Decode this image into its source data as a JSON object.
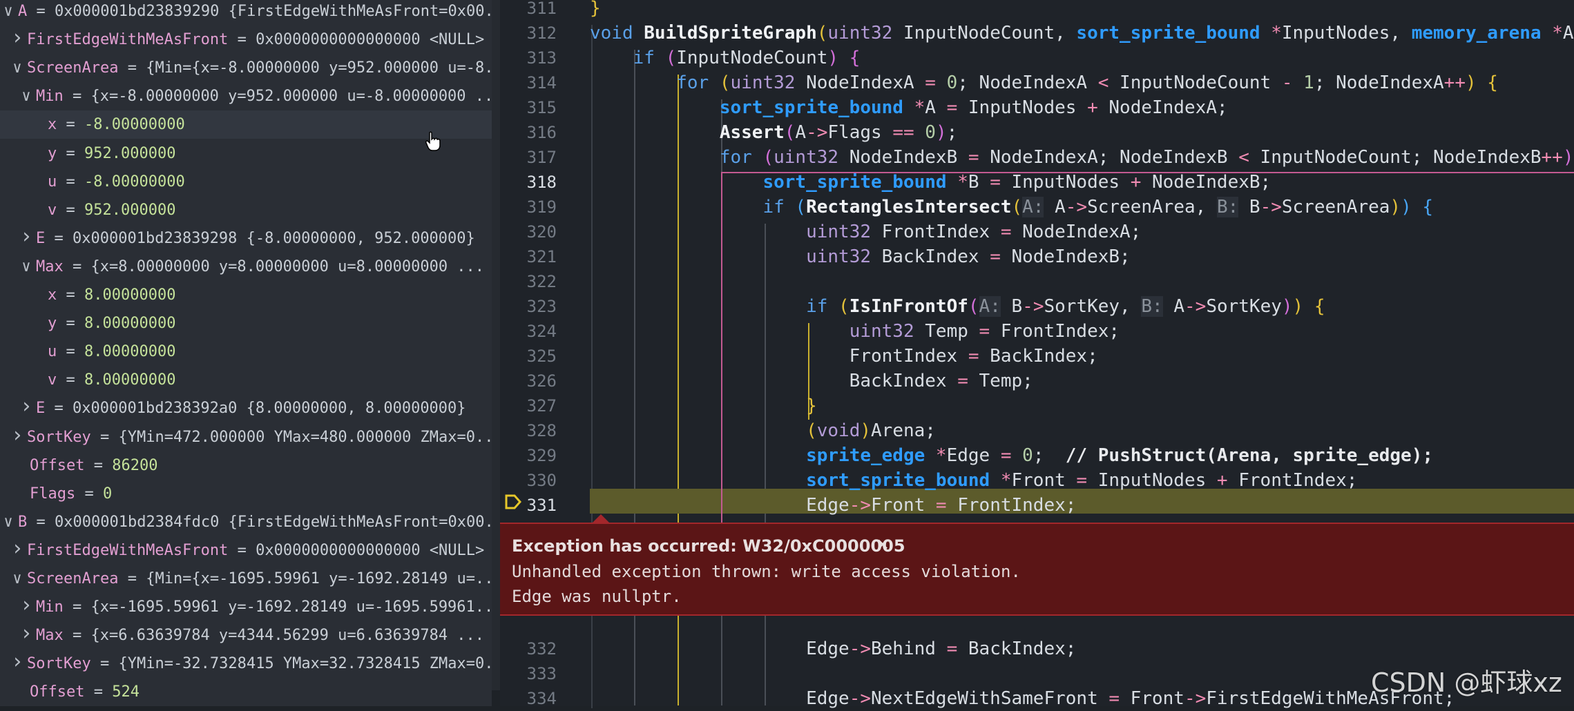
{
  "variables": [
    {
      "expand": "open",
      "name": "A",
      "value": "0x000001bd23839290 {FirstEdgeWithMeAsFront=0x00..."
    },
    {
      "expand": "closed",
      "name": "FirstEdgeWithMeAsFront",
      "value": "0x0000000000000000 <NULL>"
    },
    {
      "expand": "open",
      "name": "ScreenArea",
      "value": "{Min={x=-8.00000000 y=952.000000 u=-8..."
    },
    {
      "expand": "open",
      "name": "Min",
      "value": "{x=-8.00000000 y=952.000000 u=-8.00000000 ..."
    },
    {
      "expand": "none",
      "name": "x",
      "value": "-8.00000000"
    },
    {
      "expand": "none",
      "name": "y",
      "value": "952.000000"
    },
    {
      "expand": "none",
      "name": "u",
      "value": "-8.00000000"
    },
    {
      "expand": "none",
      "name": "v",
      "value": "952.000000"
    },
    {
      "expand": "closed",
      "name": "E",
      "value": "0x000001bd23839298 {-8.00000000, 952.000000}"
    },
    {
      "expand": "open",
      "name": "Max",
      "value": "{x=8.00000000 y=8.00000000 u=8.00000000 ..."
    },
    {
      "expand": "none",
      "name": "x",
      "value": "8.00000000"
    },
    {
      "expand": "none",
      "name": "y",
      "value": "8.00000000"
    },
    {
      "expand": "none",
      "name": "u",
      "value": "8.00000000"
    },
    {
      "expand": "none",
      "name": "v",
      "value": "8.00000000"
    },
    {
      "expand": "closed",
      "name": "E",
      "value": "0x000001bd238392a0 {8.00000000, 8.00000000}"
    },
    {
      "expand": "closed",
      "name": "SortKey",
      "value": "{YMin=472.000000 YMax=480.000000 ZMax=0..."
    },
    {
      "expand": "none",
      "name": "Offset",
      "value": "86200"
    },
    {
      "expand": "none",
      "name": "Flags",
      "value": "0"
    },
    {
      "expand": "open",
      "name": "B",
      "value": "0x000001bd2384fdc0 {FirstEdgeWithMeAsFront=0x00..."
    },
    {
      "expand": "closed",
      "name": "FirstEdgeWithMeAsFront",
      "value": "0x0000000000000000 <NULL>"
    },
    {
      "expand": "open",
      "name": "ScreenArea",
      "value": "{Min={x=-1695.59961 y=-1692.28149 u=..."
    },
    {
      "expand": "closed",
      "name": "Min",
      "value": "{x=-1695.59961 y=-1692.28149 u=-1695.59961..."
    },
    {
      "expand": "closed",
      "name": "Max",
      "value": "{x=6.63639784 y=4344.56299 u=6.63639784 ..."
    },
    {
      "expand": "closed",
      "name": "SortKey",
      "value": "{YMin=-32.7328415 YMax=32.7328415 ZMax=0..."
    },
    {
      "expand": "none",
      "name": "Offset",
      "value": "524"
    }
  ],
  "editor": {
    "line_numbers": [
      "311",
      "312",
      "313",
      "314",
      "315",
      "316",
      "317",
      "318",
      "319",
      "320",
      "321",
      "322",
      "323",
      "324",
      "325",
      "326",
      "327",
      "328",
      "329",
      "330",
      "331"
    ],
    "line_numbers_after": [
      "332",
      "333",
      "334"
    ],
    "active_line": "318",
    "breakpoint_line": "331"
  },
  "exception": {
    "title": "Exception has occurred: W32/0xC0000005",
    "close": "×",
    "message": "Unhandled exception thrown: write access violation.",
    "detail": "Edge was nullptr."
  },
  "watermark": "CSDN @虾球xz",
  "colors": {
    "exception_bg": "#5b1516",
    "current_line": "#5c5b2b",
    "breakpoint": "#e6c72a"
  }
}
